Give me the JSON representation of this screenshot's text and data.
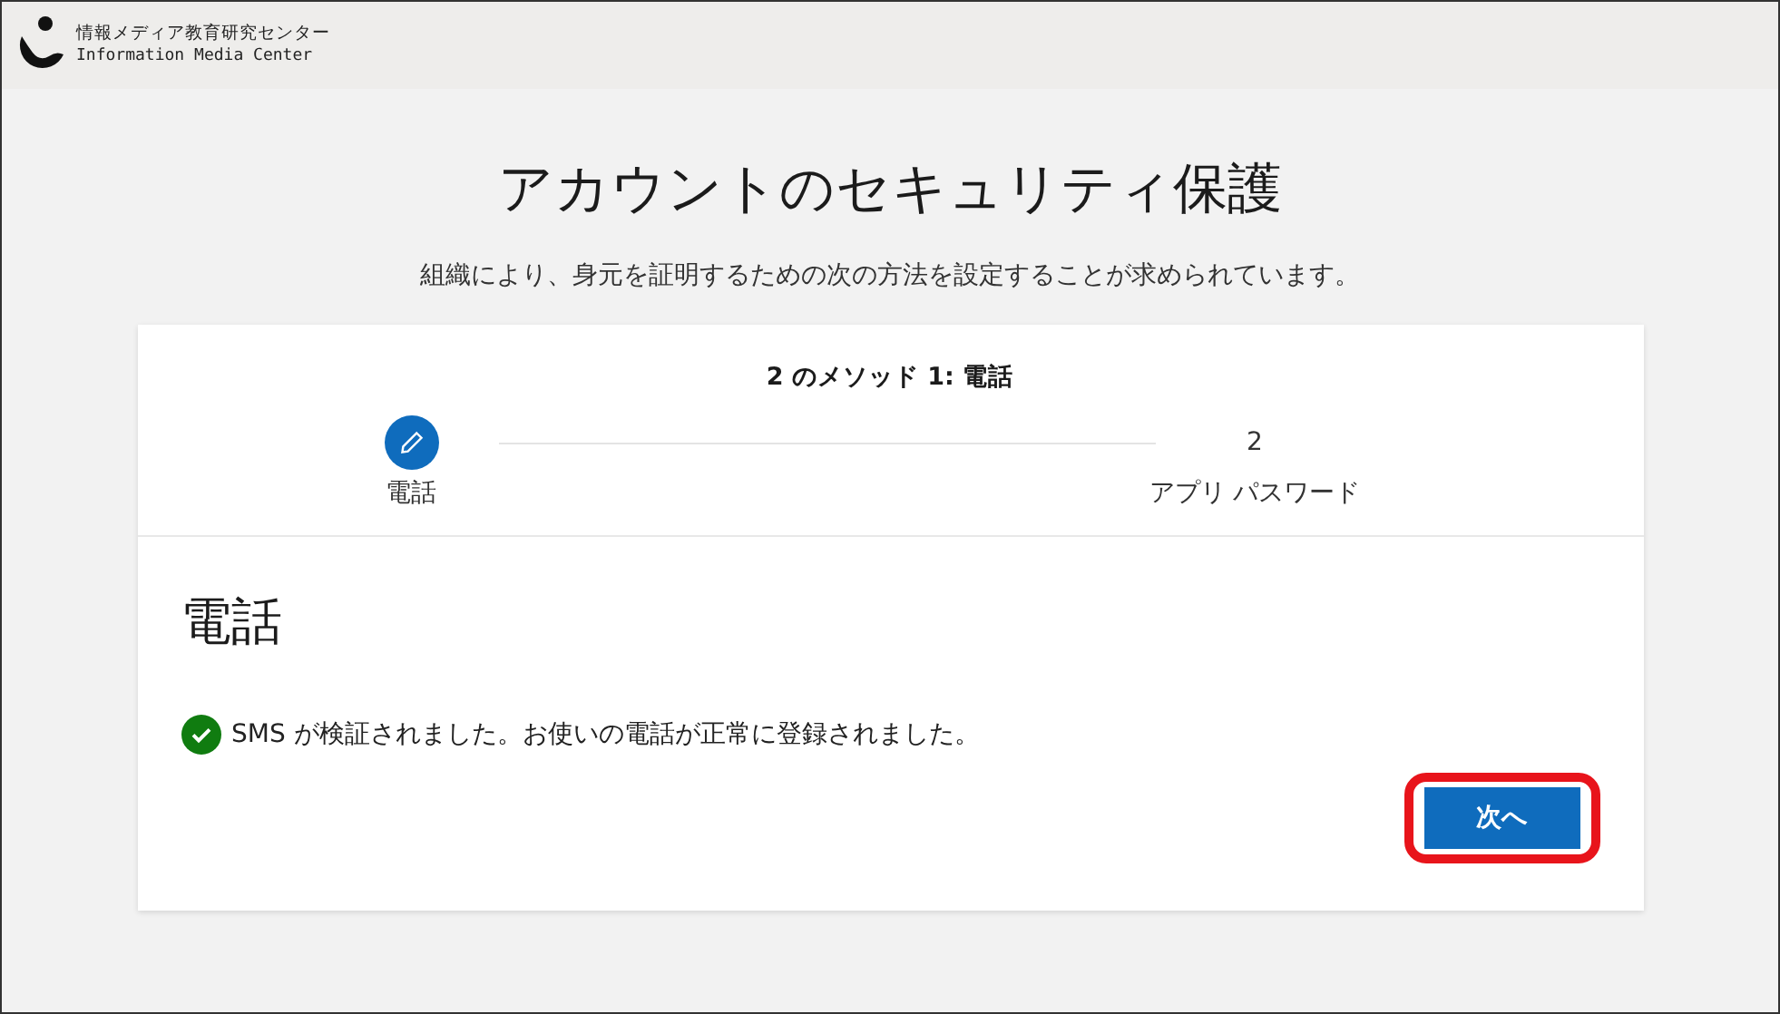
{
  "header": {
    "org_name": "情報メディア教育研究センター",
    "org_name_en": "Information Media Center"
  },
  "title": "アカウントのセキュリティ保護",
  "subtitle": "組織により、身元を証明するための次の方法を設定することが求められています。",
  "wizard": {
    "progress": "2 のメソッド 1: 電話",
    "steps": [
      {
        "label": "電話",
        "selected": true
      },
      {
        "number": "2",
        "label": "アプリ パスワード",
        "selected": false
      }
    ],
    "section_title": "電話",
    "message": {
      "kind": "success",
      "text": "SMS が検証されました。お使いの電話が正常に登録されました。"
    },
    "next_button": {
      "label": "次へ",
      "highlighted": true
    }
  }
}
